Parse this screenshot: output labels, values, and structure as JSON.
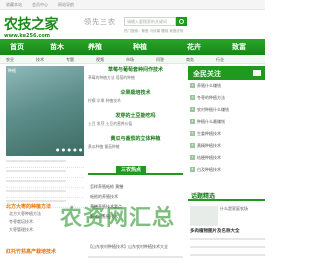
{
  "top": {
    "left": "收藏本站",
    "mid": "会员中心",
    "right": "网站导航"
  },
  "logo": {
    "name": "农技之家",
    "url": "www.ke256.com"
  },
  "slogan": "领先三农",
  "search": {
    "placeholder": "请输入要搜索的关键词",
    "hot": "热门搜索：葡萄 马铃薯 樱桃 家庭农场"
  },
  "nav": [
    "首页",
    "苗木",
    "养殖",
    "种植",
    "花卉",
    "致富"
  ],
  "subnav": [
    "农业",
    "技术",
    "专题",
    "视频",
    "市场",
    "问答",
    "商务",
    "行业"
  ],
  "slider": {
    "caption_top": "种植",
    "caption_bottom": ""
  },
  "left": {
    "box1_title": "北方大枣的种植方法",
    "box1_items": [
      "北方大枣种植方法",
      "冬枣栽培技术",
      "大枣管理技术"
    ],
    "box2_title": "红托竹荪高产栽培技术"
  },
  "center": {
    "headlines": [
      {
        "title": "草莓与葡萄套种间作技术",
        "sub": "草莓的种植方法 葡萄的种植"
      },
      {
        "title": "伞果栽培技术",
        "sub": "柠檬 伞果 种植技术"
      },
      {
        "title": "发芽的土豆能吃吗",
        "sub": "土豆 发芽 土豆的营养价值"
      },
      {
        "title": "黄瓜与番茄的立体种植",
        "sub": "黄瓜种植 番茄种植"
      }
    ],
    "section_tab": "三农热点",
    "list": [
      "怎样养殖蚯蚓 黄鳝",
      "蚯蚓的养殖技术",
      "黄鳝养殖技术要点",
      "野猪的养殖技术"
    ],
    "bottom": "【山东农村种植技术】山东农村种植技术大全"
  },
  "right": {
    "head": "全民关注",
    "items": [
      "养殖什么赚钱",
      "冬枣的种植方法",
      "农村种植什么赚钱",
      "种植什么最赚钱",
      "生姜种植技术",
      "黄精种植技术",
      "桔梗种植技术",
      "白及种植技术"
    ],
    "head2": "话题精选",
    "img_text": "什么是家庭农场",
    "caption": "多肉植物图片及名称大全"
  },
  "watermark": "农资网汇总"
}
